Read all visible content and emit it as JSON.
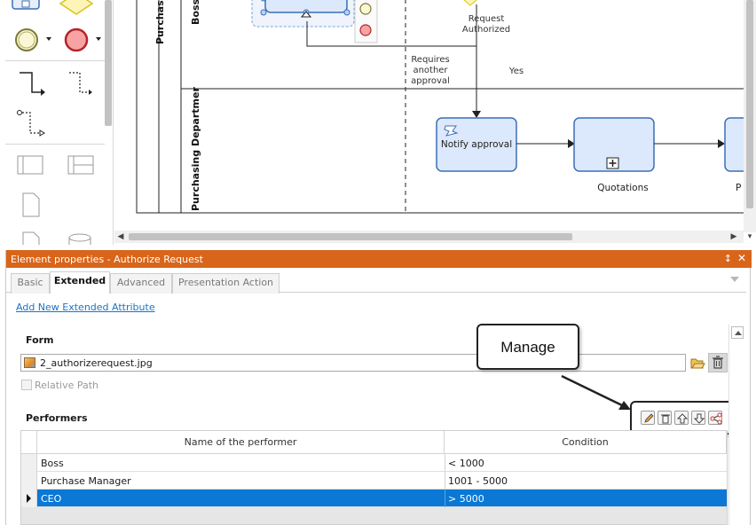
{
  "diagram": {
    "lanes": [
      "Purchas",
      "Boss",
      "Purchasing Departmer"
    ],
    "gateway_label": "Request Authorized",
    "flow_no_label": "Requires another approval",
    "flow_yes_label": "Yes",
    "tasks": [
      {
        "label": "Notify approval"
      },
      {
        "label": "Quotations"
      },
      {
        "label": "P"
      }
    ]
  },
  "panel": {
    "title": "Element properties - Authorize Request",
    "pin_glyph": "↕",
    "close_glyph": "✕",
    "tabs": [
      "Basic",
      "Extended",
      "Advanced",
      "Presentation Action"
    ],
    "active_tab": "Extended",
    "add_attribute_link": "Add New Extended Attribute",
    "form": {
      "label": "Form",
      "file_value": "2_authorizerequest.jpg",
      "relative_path_label": "Relative Path",
      "relative_path_checked": false
    },
    "performers": {
      "label": "Performers",
      "columns": [
        "Name of the performer",
        "Condition"
      ],
      "rows": [
        {
          "name": "Boss",
          "condition": "< 1000"
        },
        {
          "name": "Purchase Manager",
          "condition": "1001 - 5000"
        },
        {
          "name": "CEO",
          "condition": "> 5000"
        }
      ],
      "selected_row": 2,
      "toolbar_icons": [
        "edit-icon",
        "delete-icon",
        "move-up-icon",
        "move-down-icon",
        "share-icon"
      ]
    },
    "callout": "Manage"
  },
  "colors": {
    "title_bar": "#d9651a",
    "selection": "#0a78d4",
    "task_fill": "#dce8fb",
    "task_stroke": "#3b6fb6",
    "link": "#1a73c8"
  }
}
